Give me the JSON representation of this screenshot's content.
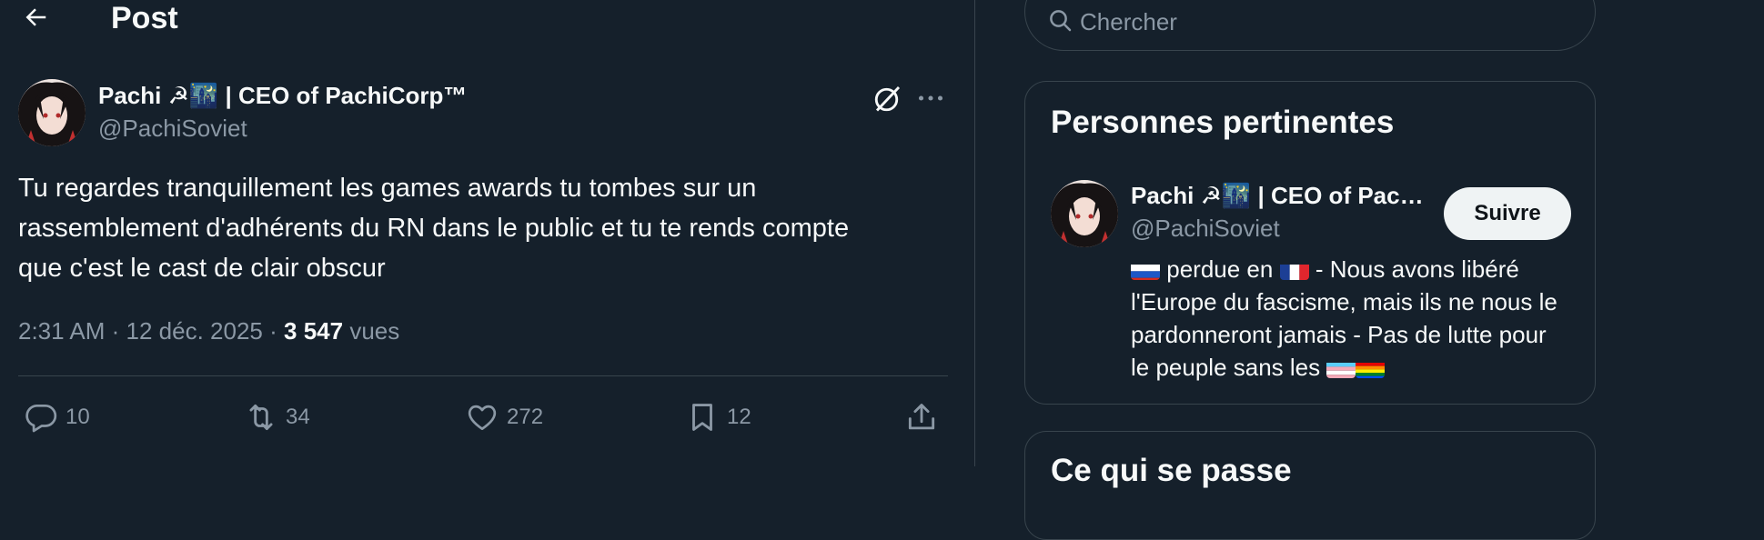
{
  "header": {
    "title": "Post"
  },
  "tweet": {
    "author_name": "Pachi ☭🌃 | CEO of PachiCorp™",
    "author_handle": "@PachiSoviet",
    "text": "Tu regardes tranquillement les games awards tu tombes sur un\nrassemblement d'adhérents du RN dans le public et tu te rends compte\nque c'est le cast de clair obscur",
    "time": "2:31 AM",
    "date": "12 déc. 2025",
    "views_count": "3 547",
    "views_label": "vues",
    "actions": {
      "replies": "10",
      "reposts": "34",
      "likes": "272",
      "bookmarks": "12"
    }
  },
  "search": {
    "placeholder": "Chercher"
  },
  "relevant_people": {
    "title": "Personnes pertinentes",
    "person": {
      "name": "Pachi ☭🌃 | CEO of PachiCorp™",
      "handle": "@PachiSoviet",
      "follow_label": "Suivre",
      "bio_part1": "perdue en",
      "bio_part2": "- Nous avons libéré l'Europe du fascisme, mais ils ne nous le pardonneront jamais - Pas de lutte pour le peuple sans les"
    }
  },
  "whats_happening": {
    "title": "Ce qui se passe"
  },
  "colors": {
    "background": "#15202b",
    "border": "#38444d",
    "muted": "#8b98a5",
    "text": "#f7f9f9"
  },
  "icons": [
    "back-arrow-icon",
    "grok-icon",
    "more-icon",
    "reply-icon",
    "repost-icon",
    "like-icon",
    "bookmark-icon",
    "share-icon",
    "search-icon",
    "flag-russia-icon",
    "flag-france-icon",
    "flag-trans-icon",
    "flag-rainbow-icon"
  ]
}
